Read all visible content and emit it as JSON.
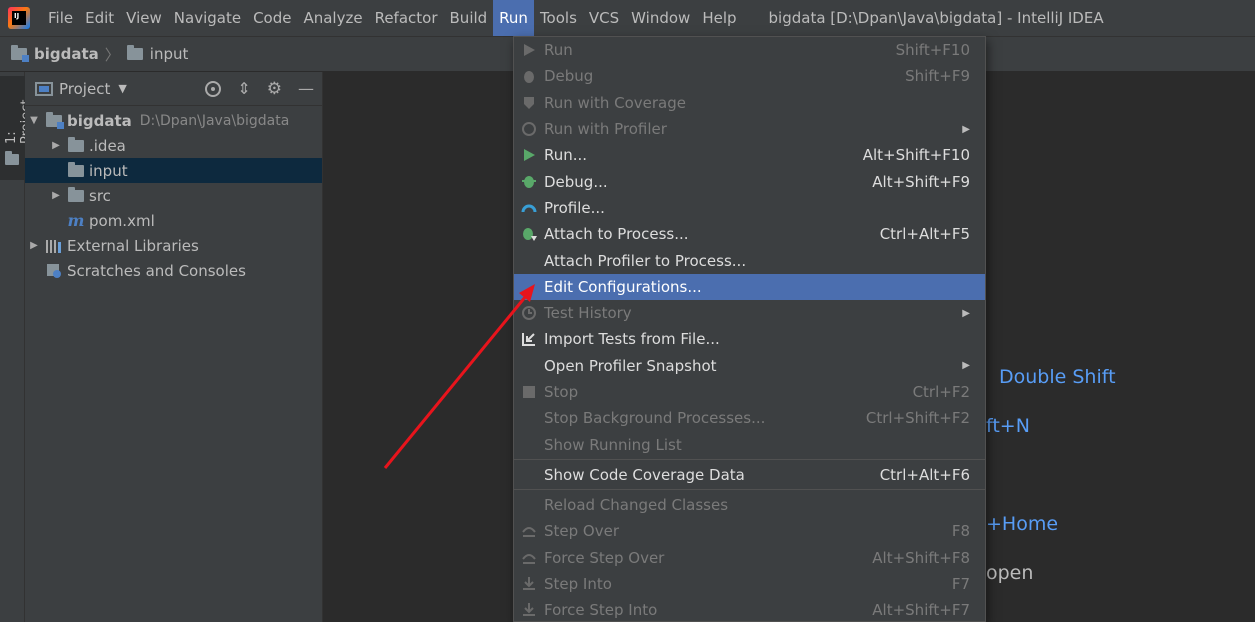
{
  "menubar": {
    "items": [
      "File",
      "Edit",
      "View",
      "Navigate",
      "Code",
      "Analyze",
      "Refactor",
      "Build",
      "Run",
      "Tools",
      "VCS",
      "Window",
      "Help"
    ],
    "active": "Run",
    "title": "bigdata [D:\\Dpan\\Java\\bigdata] - IntelliJ IDEA"
  },
  "breadcrumb": {
    "project": "bigdata",
    "folder": "input"
  },
  "toolstrip": {
    "tab_label": "1: Project"
  },
  "project_panel": {
    "title": "Project",
    "tree": [
      {
        "label": "bigdata",
        "hint": "D:\\Dpan\\Java\\bigdata",
        "icon": "module-folder-icon",
        "expanded": true
      },
      {
        "label": ".idea",
        "icon": "folder-icon",
        "expanded": false
      },
      {
        "label": "input",
        "icon": "folder-icon",
        "selected": true
      },
      {
        "label": "src",
        "icon": "folder-icon",
        "expanded": false
      },
      {
        "label": "pom.xml",
        "icon": "maven-icon"
      },
      {
        "label": "External Libraries",
        "icon": "libraries-icon",
        "expanded": false
      },
      {
        "label": "Scratches and Consoles",
        "icon": "scratches-icon"
      }
    ]
  },
  "editor_hints": {
    "h1": "Double Shift",
    "h2": "ft+N",
    "h3": "+Home",
    "h4": "open"
  },
  "run_menu": {
    "items": [
      {
        "label": "Run",
        "shortcut": "Shift+F10",
        "disabled": true,
        "icon": "run-icon"
      },
      {
        "label": "Debug",
        "shortcut": "Shift+F9",
        "disabled": true,
        "icon": "debug-icon"
      },
      {
        "label": "Run with Coverage",
        "disabled": true,
        "icon": "coverage-icon"
      },
      {
        "label": "Run with Profiler",
        "disabled": true,
        "submenu": true,
        "icon": "profiler-icon"
      },
      {
        "label": "Run...",
        "shortcut": "Alt+Shift+F10",
        "icon": "run-icon"
      },
      {
        "label": "Debug...",
        "shortcut": "Alt+Shift+F9",
        "icon": "debug-icon"
      },
      {
        "label": "Profile...",
        "icon": "profile-icon"
      },
      {
        "label": "Attach to Process...",
        "shortcut": "Ctrl+Alt+F5",
        "icon": "attach-icon"
      },
      {
        "label": "Attach Profiler to Process..."
      },
      {
        "label": "Edit Configurations...",
        "selected": true
      },
      {
        "label": "Test History",
        "disabled": true,
        "submenu": true,
        "icon": "history-icon"
      },
      {
        "label": "Import Tests from File...",
        "icon": "import-icon"
      },
      {
        "label": "Open Profiler Snapshot",
        "submenu": true
      },
      {
        "label": "Stop",
        "shortcut": "Ctrl+F2",
        "disabled": true,
        "icon": "stop-icon"
      },
      {
        "label": "Stop Background Processes...",
        "shortcut": "Ctrl+Shift+F2",
        "disabled": true
      },
      {
        "label": "Show Running List",
        "disabled": true
      },
      {
        "separator": true
      },
      {
        "label": "Show Code Coverage Data",
        "shortcut": "Ctrl+Alt+F6"
      },
      {
        "separator": true
      },
      {
        "label": "Reload Changed Classes",
        "disabled": true
      },
      {
        "label": "Step Over",
        "shortcut": "F8",
        "disabled": true,
        "icon": "step-over-icon"
      },
      {
        "label": "Force Step Over",
        "shortcut": "Alt+Shift+F8",
        "disabled": true,
        "icon": "force-step-over-icon"
      },
      {
        "label": "Step Into",
        "shortcut": "F7",
        "disabled": true,
        "icon": "step-into-icon"
      },
      {
        "label": "Force Step Into",
        "shortcut": "Alt+Shift+F7",
        "disabled": true,
        "icon": "force-step-into-icon"
      }
    ]
  },
  "colors": {
    "accent": "#4b6eaf",
    "selection_tree": "#0d293e",
    "hint_blue": "#589df6",
    "annotation_arrow": "#e8141c"
  }
}
